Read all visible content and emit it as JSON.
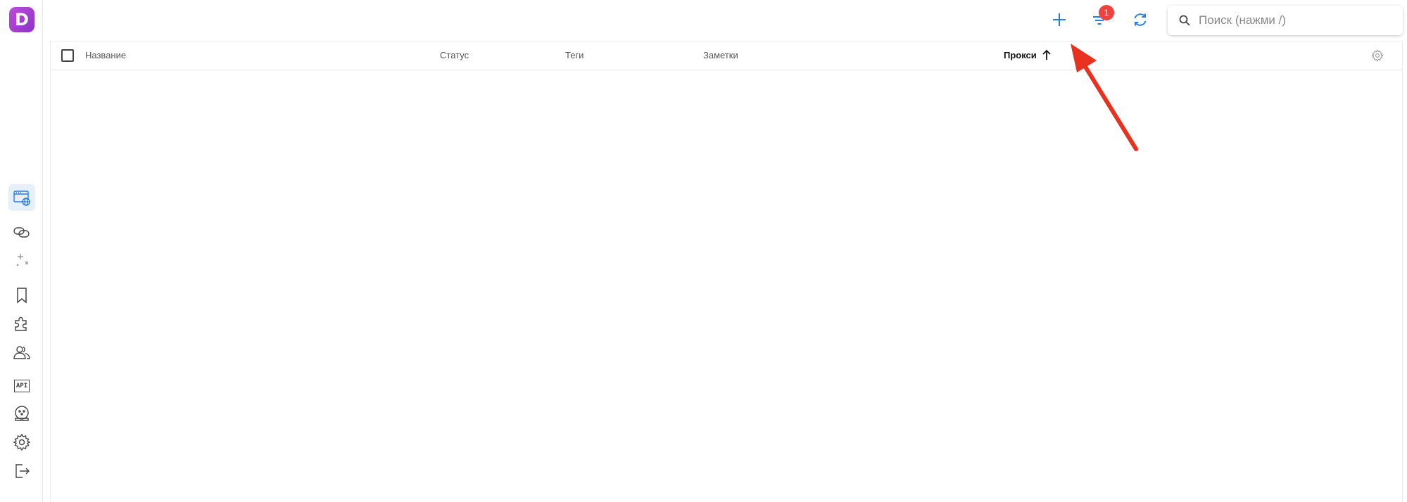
{
  "sidebar": {
    "logo_letter": "D",
    "items": [
      {
        "icon": "browser-profiles-icon",
        "active": true
      },
      {
        "icon": "links-icon"
      },
      {
        "icon": "sparkles-icon"
      },
      {
        "icon": "bookmark-icon"
      },
      {
        "icon": "extensions-icon"
      },
      {
        "icon": "users-icon"
      },
      {
        "label": "API",
        "icon": "api-icon"
      },
      {
        "icon": "robot-icon"
      },
      {
        "icon": "gear-icon"
      },
      {
        "icon": "logout-icon"
      }
    ]
  },
  "topbar": {
    "add_icon": "plus-icon",
    "filter_icon": "filter-icon",
    "filter_badge": "1",
    "refresh_icon": "refresh-icon",
    "search": {
      "placeholder": "Поиск (нажми /)",
      "value": ""
    }
  },
  "table": {
    "columns": {
      "name": "Название",
      "status": "Статус",
      "tags": "Теги",
      "notes": "Заметки",
      "proxy": "Прокси"
    },
    "sorted_column": "proxy",
    "sort_direction": "ascending",
    "rows": []
  },
  "colors": {
    "accent": "#2a7de1",
    "badge": "#f0423c",
    "annotation_arrow": "#e8321f",
    "logo_gradient": [
      "#c04bd8",
      "#8a33c9"
    ]
  }
}
